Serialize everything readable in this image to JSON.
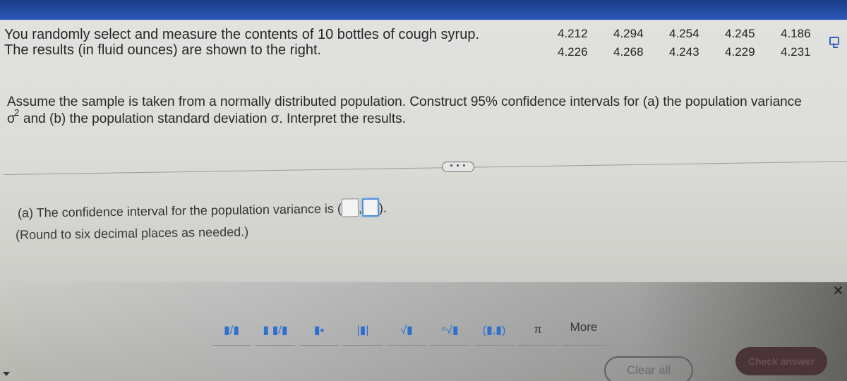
{
  "problem": {
    "intro_line1": "You randomly select and measure the contents of 10 bottles of cough syrup.",
    "intro_line2": "The results (in fluid ounces) are shown to the right.",
    "data_values": [
      "4.212",
      "4.294",
      "4.254",
      "4.245",
      "4.186",
      "4.226",
      "4.268",
      "4.243",
      "4.229",
      "4.231"
    ],
    "instruction_line1": "Assume the sample is taken from a normally distributed population. Construct 95% confidence intervals for (a) the population variance",
    "sigma_symbol": "σ",
    "sigma_exponent": "2",
    "instruction_line2": "and (b) the population standard deviation σ. Interpret the results."
  },
  "expand_button_label": "• • •",
  "answer": {
    "part_a_prefix": "(a) The confidence interval for the population variance is (",
    "separator": ",",
    "suffix": ").",
    "lower_value": "",
    "upper_value": "",
    "round_note": "(Round to six decimal places as needed.)"
  },
  "math_toolbar": {
    "tools": [
      {
        "name": "fraction",
        "glyph": "▮/▮"
      },
      {
        "name": "mixed-number",
        "glyph": "▮ ▮/▮"
      },
      {
        "name": "exponent",
        "glyph": "▮▪"
      },
      {
        "name": "absolute-value",
        "glyph": "|▮|"
      },
      {
        "name": "square-root",
        "glyph": "√▮"
      },
      {
        "name": "nth-root",
        "glyph": "ⁿ√▮"
      },
      {
        "name": "ordered-pair",
        "glyph": "(▮,▮)"
      },
      {
        "name": "pi",
        "glyph": "π"
      }
    ],
    "more_label": "More"
  },
  "buttons": {
    "clear_all": "Clear all",
    "check_answer": "Check answer"
  }
}
